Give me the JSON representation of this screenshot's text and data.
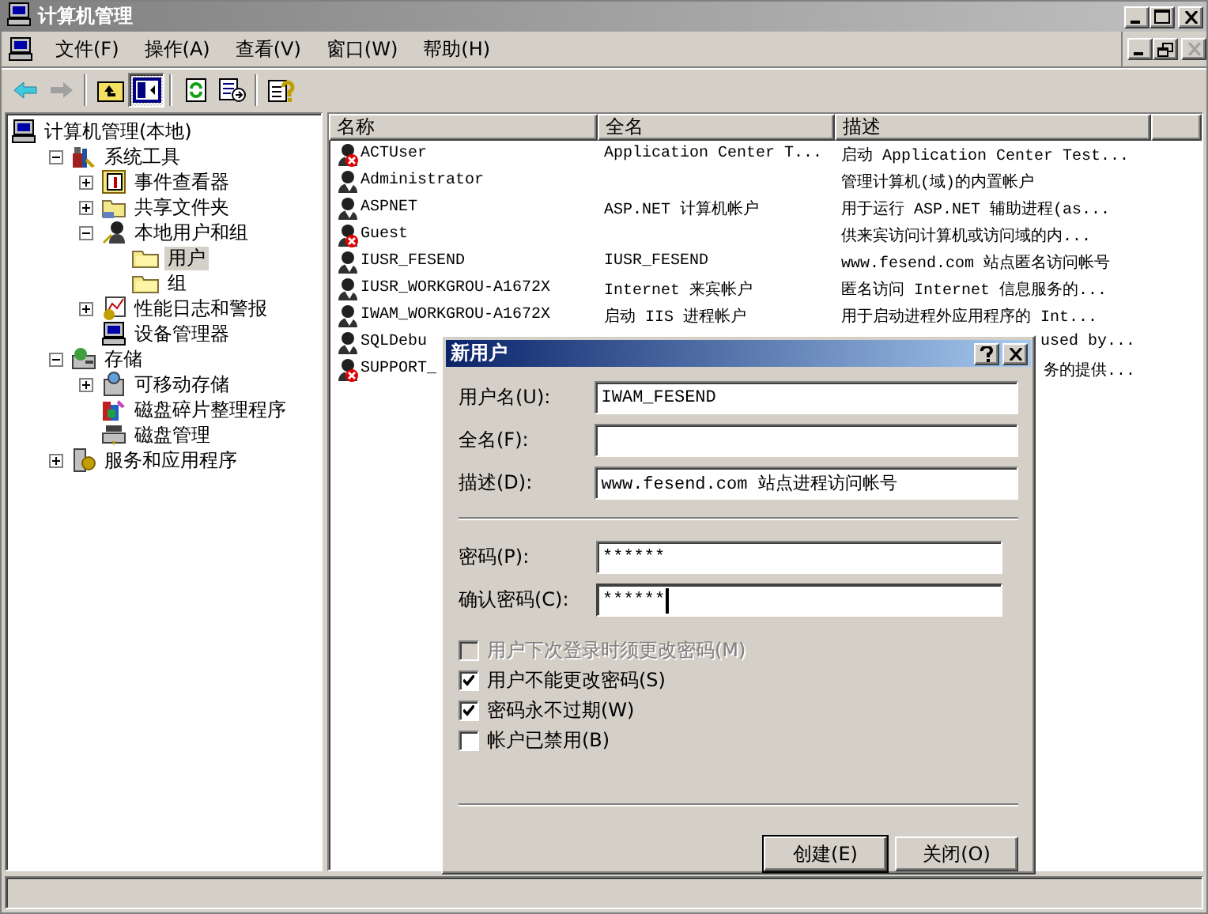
{
  "window": {
    "title": "计算机管理",
    "active": false
  },
  "menu": [
    "文件(F)",
    "操作(A)",
    "查看(V)",
    "窗口(W)",
    "帮助(H)"
  ],
  "toolbar": [
    {
      "kind": "back",
      "disabled": false
    },
    {
      "kind": "forward",
      "disabled": true
    },
    {
      "kind": "up"
    },
    {
      "kind": "tree-toggle",
      "pressed": true
    },
    {
      "kind": "refresh"
    },
    {
      "kind": "export"
    },
    {
      "kind": "help"
    }
  ],
  "tree": [
    {
      "label": "计算机管理(本地)",
      "selected": false,
      "children": [
        {
          "label": "系统工具",
          "expanded": true,
          "selected": false,
          "children": [
            {
              "label": "事件查看器",
              "expanded": false,
              "selected": false
            },
            {
              "label": "共享文件夹",
              "expanded": false,
              "selected": false
            },
            {
              "label": "本地用户和组",
              "expanded": true,
              "selected": false,
              "children": [
                {
                  "label": "用户",
                  "selected": true
                },
                {
                  "label": "组",
                  "selected": false
                }
              ]
            },
            {
              "label": "性能日志和警报",
              "expanded": false,
              "selected": false
            },
            {
              "label": "设备管理器",
              "selected": false
            }
          ]
        },
        {
          "label": "存储",
          "expanded": true,
          "selected": false,
          "children": [
            {
              "label": "可移动存储",
              "expanded": false,
              "selected": false
            },
            {
              "label": "磁盘碎片整理程序",
              "selected": false
            },
            {
              "label": "磁盘管理",
              "selected": false
            }
          ]
        },
        {
          "label": "服务和应用程序",
          "expanded": false,
          "selected": false
        }
      ]
    }
  ],
  "list": {
    "columns": [
      "名称",
      "全名",
      "描述"
    ],
    "rows": [
      {
        "kind": "user",
        "name": "ACTUser",
        "full_name": "Application Center T...",
        "description": "启动 Application Center Test...",
        "disabled": true
      },
      {
        "kind": "user",
        "name": "Administrator",
        "description": "管理计算机(域)的内置帐户",
        "disabled": false
      },
      {
        "kind": "user",
        "name": "ASPNET",
        "full_name": "ASP.NET 计算机帐户",
        "description": "用于运行 ASP.NET 辅助进程(as...",
        "disabled": false
      },
      {
        "kind": "user",
        "name": "Guest",
        "description": "供来宾访问计算机或访问域的内...",
        "disabled": true
      },
      {
        "kind": "user",
        "name": "IUSR_FESEND",
        "full_name": "IUSR_FESEND",
        "description": "www.fesend.com 站点匿名访问帐号",
        "disabled": false
      },
      {
        "kind": "user",
        "name": "IUSR_WORKGROU-A1672X",
        "full_name": "Internet 来宾帐户",
        "description": "匿名访问 Internet 信息服务的...",
        "disabled": false
      },
      {
        "kind": "user",
        "name": "IWAM_WORKGROU-A1672X",
        "full_name": "启动 IIS 进程帐户",
        "description": "用于启动进程外应用程序的 Int...",
        "disabled": false
      },
      {
        "kind": "covered",
        "name": "SQLDebu",
        "description": "used by...",
        "disabled": false
      },
      {
        "kind": "covered",
        "name": "SUPPORT_",
        "description": "务的提供...",
        "disabled": true
      }
    ]
  },
  "dialog": {
    "title": "新用户",
    "fields": [
      {
        "label": "用户名(U):",
        "value": "IWAM_FESEND"
      },
      {
        "label": "全名(F):"
      },
      {
        "label": "描述(D):",
        "value": "www.fesend.com 站点进程访问帐号"
      }
    ],
    "passwords": [
      {
        "label": "密码(P):",
        "value": "******",
        "focused": false
      },
      {
        "label": "确认密码(C):",
        "value": "******",
        "focused": true
      }
    ],
    "options": [
      {
        "label": "用户下次登录时须更改密码(M)",
        "checked": false,
        "disabled": true
      },
      {
        "label": "用户不能更改密码(S)",
        "checked": true,
        "disabled": false
      },
      {
        "label": "密码永不过期(W)",
        "checked": true,
        "disabled": false
      },
      {
        "label": "帐户已禁用(B)",
        "checked": false,
        "disabled": false
      }
    ],
    "buttons": [
      {
        "label": "创建(E)",
        "default": true
      },
      {
        "label": "关闭(O)",
        "default": false
      }
    ]
  }
}
